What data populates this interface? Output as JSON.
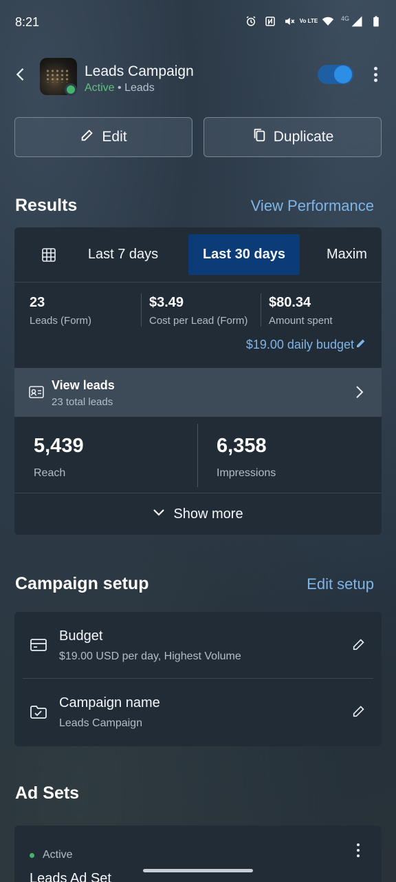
{
  "status_bar": {
    "time": "8:21",
    "lte_label": "Vo LTE",
    "network": "4G",
    "icons": [
      "alarm-icon",
      "nfc-icon",
      "mute-icon",
      "volte-icon",
      "wifi-icon",
      "signal-icon",
      "battery-icon"
    ]
  },
  "header": {
    "title": "Leads Campaign",
    "status": "Active",
    "separator": "•",
    "type": "Leads",
    "toggle_on": true,
    "status_color": "#45b36b"
  },
  "actions": {
    "edit_label": "Edit",
    "duplicate_label": "Duplicate"
  },
  "results": {
    "title": "Results",
    "link": "View Performance",
    "tabs": [
      {
        "label": "Last 7 days",
        "selected": false
      },
      {
        "label": "Last 30 days",
        "selected": true
      },
      {
        "label": "Maxim",
        "selected": false
      }
    ],
    "metrics": [
      {
        "value": "23",
        "label": "Leads (Form)"
      },
      {
        "value": "$3.49",
        "label": "Cost per Lead (Form)"
      },
      {
        "value": "$80.34",
        "label": "Amount spent"
      }
    ],
    "daily_budget": "$19.00 daily budget",
    "view_leads": {
      "title": "View leads",
      "subtitle": "23 total leads"
    },
    "reach": {
      "value": "5,439",
      "label": "Reach"
    },
    "impressions": {
      "value": "6,358",
      "label": "Impressions"
    },
    "show_more": "Show more"
  },
  "setup": {
    "title": "Campaign setup",
    "link": "Edit setup",
    "rows": [
      {
        "title": "Budget",
        "subtitle": "$19.00 USD per day, Highest Volume"
      },
      {
        "title": "Campaign name",
        "subtitle": "Leads Campaign"
      }
    ]
  },
  "ad_sets": {
    "title": "Ad Sets",
    "items": [
      {
        "status": "Active",
        "name": "Leads Ad Set"
      }
    ]
  },
  "colors": {
    "accent_link": "#7fb5e6",
    "selected_tab": "#0c3c78",
    "toggle": "#2d8ee6",
    "active": "#45b36b"
  }
}
